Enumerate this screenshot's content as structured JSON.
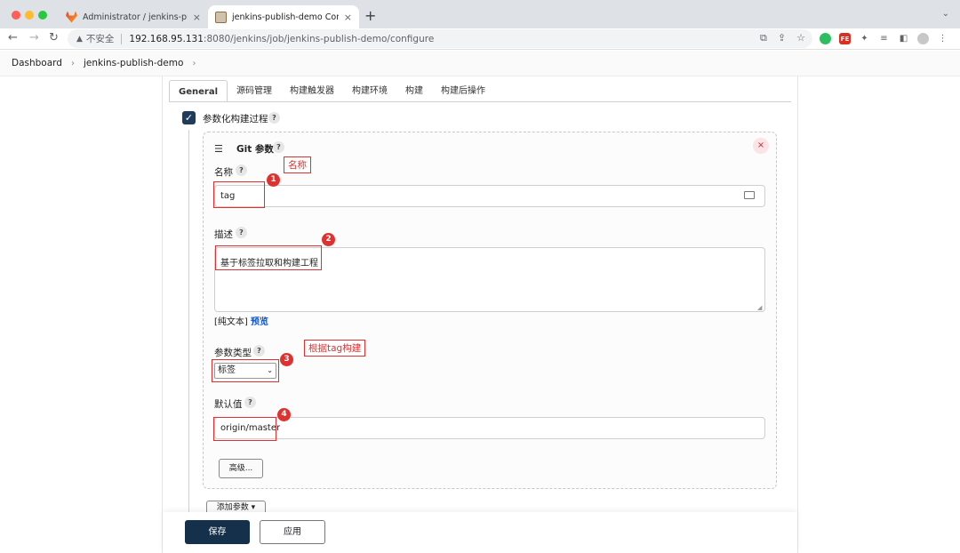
{
  "browser": {
    "tabs": [
      {
        "title": "Administrator / jenkins-publish",
        "close": "×"
      },
      {
        "title": "jenkins-publish-demo Config [",
        "close": "×"
      }
    ],
    "new_tab": "+",
    "tab_menu": "⌄",
    "insecure_label": "不安全",
    "url_host": "192.168.95.131",
    "url_rest": ":8080/jenkins/job/jenkins-publish-demo/configure"
  },
  "breadcrumb": {
    "items": [
      "Dashboard",
      "jenkins-publish-demo"
    ],
    "separator": "›"
  },
  "config_tabs": [
    "General",
    "源码管理",
    "构建触发器",
    "构建环境",
    "构建",
    "构建后操作"
  ],
  "parameterized": {
    "label": "参数化构建过程",
    "checked": true,
    "help": "?"
  },
  "git_param": {
    "title": "Git 参数",
    "help": "?",
    "name_label": "名称",
    "name_value": "tag",
    "desc_label": "描述",
    "desc_value": "基于标签拉取和构建工程",
    "format_prefix": "[纯文本]",
    "preview_link": "预览",
    "type_label": "参数类型",
    "type_value": "标签",
    "default_label": "默认值",
    "default_value": "origin/master",
    "advanced_button": "高级...",
    "remove": "×"
  },
  "add_param_button": "添加参数 ▾",
  "save_button": "保存",
  "apply_button": "应用",
  "annotations": {
    "badges": [
      "1",
      "2",
      "3",
      "4"
    ],
    "note_name": "名称",
    "note_tag": "根据tag构建"
  }
}
